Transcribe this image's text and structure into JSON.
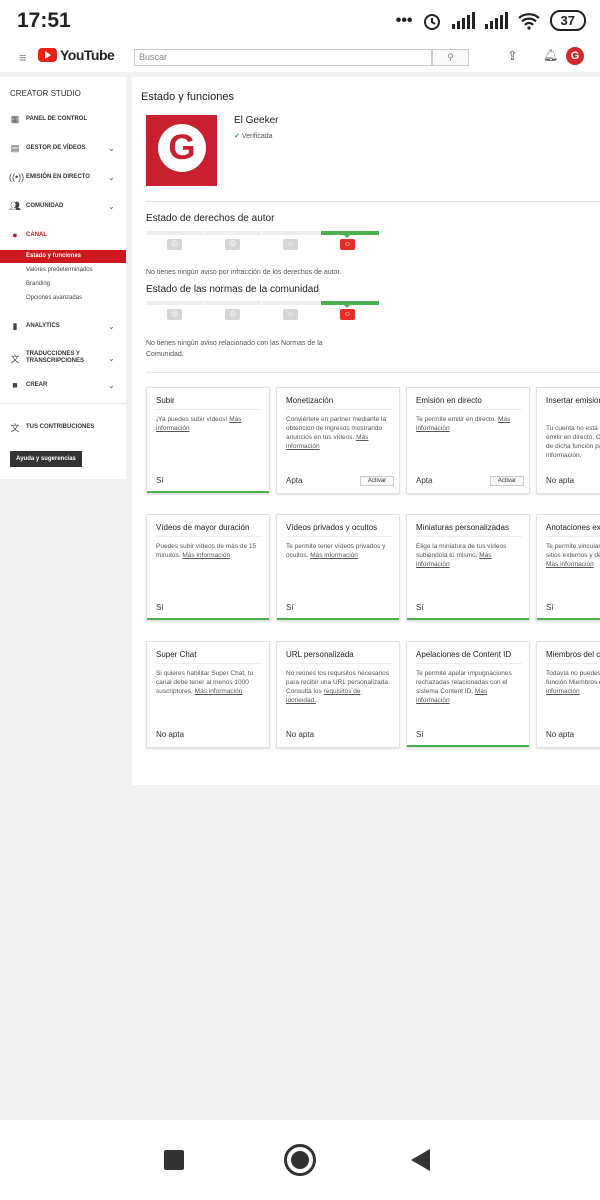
{
  "status_bar": {
    "time": "17:51",
    "battery": "37"
  },
  "header": {
    "logo_text": "YouTube",
    "search_placeholder": "Buscar"
  },
  "sidebar": {
    "title": "CREATOR STUDIO",
    "items": [
      {
        "label": "PANEL DE CONTROL",
        "icon": "dashboard-icon"
      },
      {
        "label": "GESTOR DE VÍDEOS",
        "icon": "video-manager-icon"
      },
      {
        "label": "EMISIÓN EN DIRECTO",
        "icon": "live-icon"
      },
      {
        "label": "COMUNIDAD",
        "icon": "community-icon"
      },
      {
        "label": "CANAL",
        "icon": "channel-icon"
      },
      {
        "label": "ANALYTICS",
        "icon": "analytics-icon"
      },
      {
        "label": "TRADUCCIONES Y TRANSCRIPCIONES",
        "icon": "translate-icon"
      },
      {
        "label": "CREAR",
        "icon": "create-icon"
      },
      {
        "label": "TUS CONTRIBUCIONES",
        "icon": "contributions-icon"
      }
    ],
    "channel_sub": [
      "Estado y funciones",
      "Valores predeterminados",
      "Branding",
      "Opciones avanzadas"
    ],
    "help_button": "Ayuda y sugerencias",
    "accent_color": "#cc181e"
  },
  "main": {
    "title": "Estado y funciones",
    "channel": {
      "name": "El Geeker",
      "verified": "Verificada",
      "avatar_letter": "G"
    },
    "copyright": {
      "title": "Estado de derechos de autor",
      "note": "No tienes ningún aviso por infracción de los derechos de autor."
    },
    "community": {
      "title": "Estado de las normas de la comunidad",
      "note": "No tienes ningún aviso relacionado con las Normas de la Comunidad."
    },
    "cards": [
      {
        "title": "Subir",
        "desc": "¡Ya puedes subir vídeos!",
        "link": "Más información",
        "status": "Sí",
        "ok": true
      },
      {
        "title": "Monetización",
        "desc": "Conviértete en partner mediante la obtención de ingresos mostrando anuncios en tus vídeos.",
        "link": "Más información",
        "status": "Apta",
        "button": "Activar",
        "ok": false
      },
      {
        "title": "Emisión en directo",
        "desc": "Te permite emitir en directo.",
        "link": "Más información",
        "status": "Apta",
        "button": "Activar",
        "ok": false
      },
      {
        "title": "Insertar emisiones en directo",
        "desc": "Tu cuenta no está habilitada para emitir en directo. Consulta el estado de dicha función para obtener más información.",
        "link": "",
        "status": "No apta",
        "ok": false
      },
      {
        "title": "Vídeos de mayor duración",
        "desc": "Puedes subir vídeos de más de 15 minutos.",
        "link": "Más información",
        "status": "Sí",
        "ok": true
      },
      {
        "title": "Vídeos privados y ocultos",
        "desc": "Te permite tener vídeos privados y ocultos.",
        "link": "Más información",
        "status": "Sí",
        "ok": true
      },
      {
        "title": "Miniaturas personalizadas",
        "desc": "Elige la miniatura de tus vídeos subiéndola tú mismo.",
        "link": "Más información",
        "status": "Sí",
        "ok": true
      },
      {
        "title": "Anotaciones externas",
        "desc": "Te permite vincular anotaciones con sitios externos y de merchandising.",
        "link": "Más información",
        "status": "Sí",
        "ok": true
      },
      {
        "title": "Super Chat",
        "desc": "Si quieres habilitar Super Chat, tu canal debe tener al menos 1000 suscriptores.",
        "link": "Más información",
        "status": "No apta",
        "ok": false
      },
      {
        "title": "URL personalizada",
        "desc": "No reúnes los requisitos necesarios para recibir una URL personalizada. Consulta los",
        "link": "requisitos de idoneidad.",
        "status": "No apta",
        "ok": false
      },
      {
        "title": "Apelaciones de Content ID",
        "desc": "Te permite apelar impugnaciones rechazadas relacionadas con el sistema Content ID.",
        "link": "Más información",
        "status": "Sí",
        "ok": true
      },
      {
        "title": "Miembros del canal",
        "desc": "Todavía no puedes acceder a la función Miembros del canal.",
        "link": "Más información",
        "status": "No apta",
        "ok": false
      }
    ],
    "good_color": "#4caf50",
    "bad_color": "#e52d27"
  }
}
